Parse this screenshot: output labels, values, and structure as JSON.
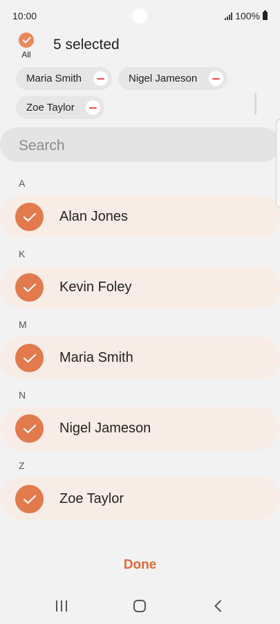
{
  "status": {
    "time": "10:00",
    "battery": "100%"
  },
  "header": {
    "all_label": "All",
    "title": "5 selected"
  },
  "chips": [
    "Maria Smith",
    "Nigel Jameson",
    "Zoe Taylor"
  ],
  "search": {
    "placeholder": "Search"
  },
  "sections": [
    {
      "letter": "A",
      "name": "Alan Jones",
      "checked": true
    },
    {
      "letter": "K",
      "name": "Kevin Foley",
      "checked": true
    },
    {
      "letter": "M",
      "name": "Maria Smith",
      "checked": true
    },
    {
      "letter": "N",
      "name": "Nigel Jameson",
      "checked": true
    },
    {
      "letter": "Z",
      "name": "Zoe Taylor",
      "checked": true
    }
  ],
  "footer": {
    "done_label": "Done"
  },
  "colors": {
    "accent": "#e17a4d",
    "done": "#dc6a38",
    "row_bg": "#f8ece6"
  }
}
